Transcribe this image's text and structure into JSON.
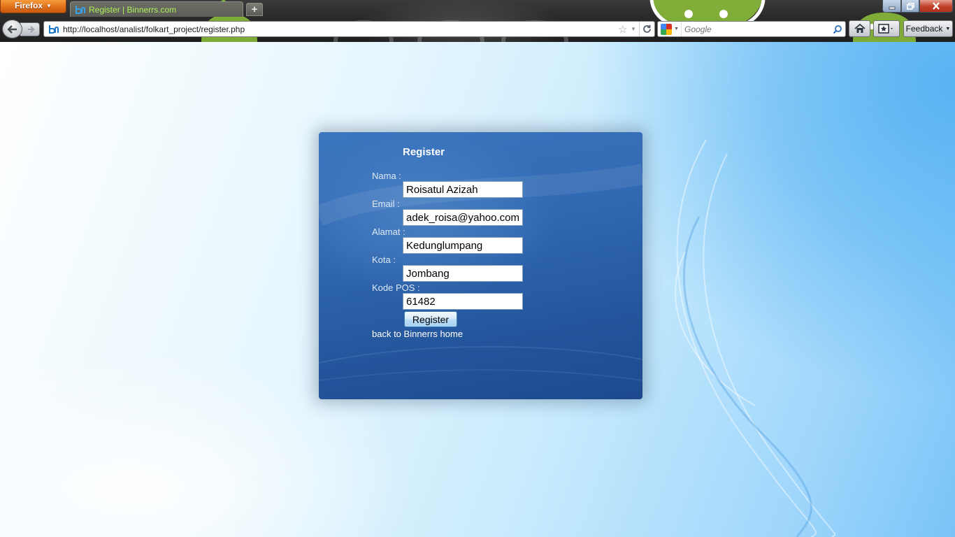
{
  "browser": {
    "menu_button_label": "Firefox",
    "tab_title": "Register | Binnerrs.com",
    "url": "http://localhost/analist/folkart_project/register.php",
    "search_placeholder": "Google",
    "feedback_label": "Feedback",
    "icons": {
      "menu_dropdown": "chevron-down-icon",
      "new_tab": "plus-icon",
      "minimize": "minimize-icon",
      "maximize": "maximize-icon",
      "close": "close-icon",
      "back": "back-arrow-icon",
      "forward": "forward-arrow-icon",
      "bookmark": "star-icon",
      "reload": "reload-icon",
      "search_engine": "google-icon",
      "search": "magnifier-icon",
      "home": "home-icon",
      "bookmarks": "bookmarks-icon"
    }
  },
  "page": {
    "form": {
      "title": "Register",
      "fields": [
        {
          "label": "Nama :",
          "value": "Roisatul Azizah"
        },
        {
          "label": "Email :",
          "value": "adek_roisa@yahoo.com"
        },
        {
          "label": "Alamat :",
          "value": "Kedunglumpang"
        },
        {
          "label": "Kota :",
          "value": "Jombang"
        },
        {
          "label": "Kode POS :",
          "value": "61482"
        }
      ],
      "submit_label": "Register",
      "back_link_text": "back to Binnerrs home"
    }
  },
  "colors": {
    "tab_title": "#aef05a",
    "panel_top": "#3c76bf",
    "panel_bottom": "#1d4a8e",
    "firefox_orange": "#e0711b"
  }
}
